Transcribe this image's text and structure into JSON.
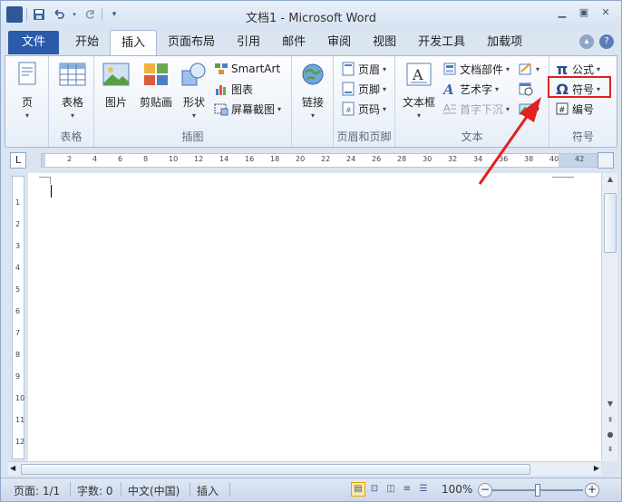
{
  "window": {
    "title": "文档1 - Microsoft Word",
    "app_icon_letter": "W"
  },
  "qat": {
    "save_icon": "save-icon",
    "undo_icon": "undo-icon",
    "redo_icon": "redo-icon",
    "customize_icon": "customize-icon"
  },
  "tabs": {
    "file": "文件",
    "items": [
      "开始",
      "插入",
      "页面布局",
      "引用",
      "邮件",
      "审阅",
      "视图",
      "开发工具",
      "加载项"
    ],
    "active_index": 1
  },
  "ribbon": {
    "pages": {
      "page_btn": "页"
    },
    "tables": {
      "table_btn": "表格",
      "label": "表格"
    },
    "illustrations": {
      "picture": "图片",
      "clipart": "剪贴画",
      "shapes": "形状",
      "smartart": "SmartArt",
      "chart": "图表",
      "screenshot": "屏幕截图",
      "label": "插图"
    },
    "links": {
      "link": "链接"
    },
    "header_footer": {
      "header": "页眉",
      "footer": "页脚",
      "page_number": "页码",
      "label": "页眉和页脚"
    },
    "text": {
      "textbox": "文本框",
      "quickparts": "文档部件",
      "wordart": "艺术字",
      "dropcap": "首字下沉",
      "label": "文本"
    },
    "symbols": {
      "equation": "公式",
      "symbol": "符号",
      "number": "编号",
      "label": "符号"
    }
  },
  "ruler": {
    "numbers": [
      "2",
      "4",
      "6",
      "8",
      "10",
      "12",
      "14",
      "16",
      "18",
      "20",
      "22",
      "24",
      "26",
      "28",
      "30",
      "32",
      "34",
      "36",
      "38",
      "40",
      "42"
    ],
    "tab_selector": "L",
    "vertical_numbers": [
      "1",
      "2",
      "3",
      "4",
      "5",
      "6",
      "7",
      "8",
      "9",
      "10",
      "11",
      "12"
    ]
  },
  "statusbar": {
    "page": "页面: 1/1",
    "words": "字数: 0",
    "language": "中文(中国)",
    "mode": "插入",
    "zoom": "100%",
    "zoom_out": "−",
    "zoom_in": "+"
  },
  "colors": {
    "file_tab": "#2a5aa8",
    "highlight": "#e3201f",
    "arrow": "#e3201f"
  }
}
